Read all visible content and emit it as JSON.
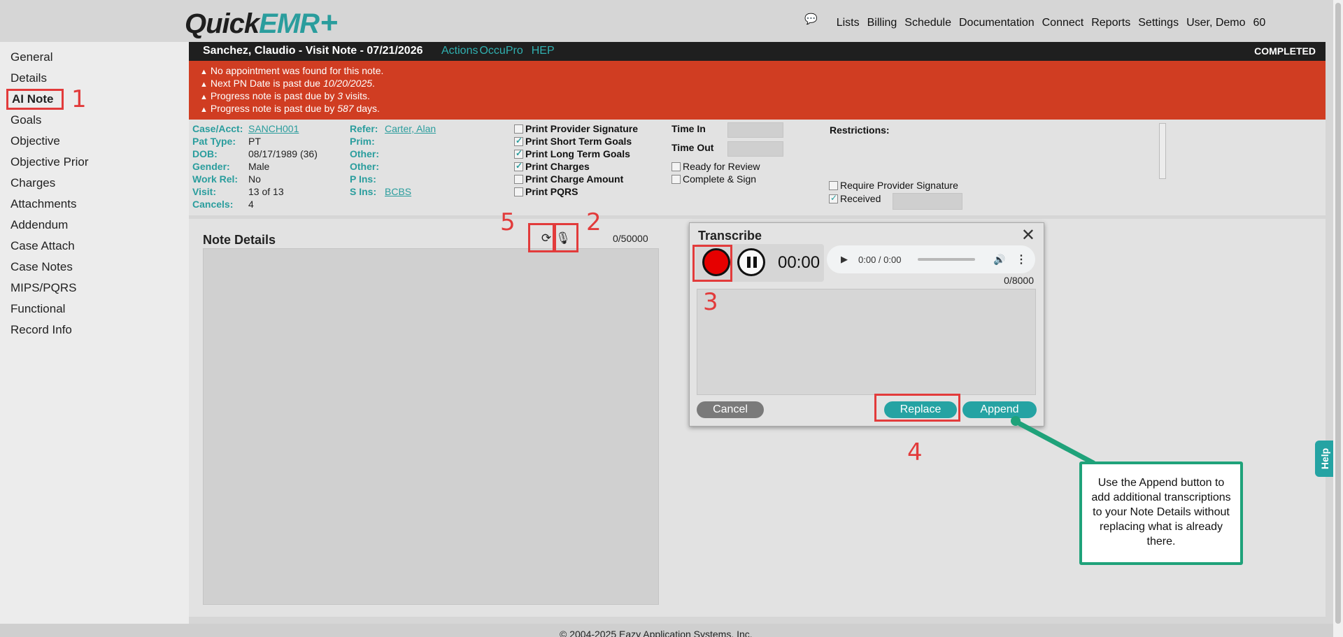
{
  "app": {
    "logo_quick": "Quick",
    "logo_emr": "EMR",
    "logo_plus": "+"
  },
  "topnav": {
    "chat_icon": "💬",
    "items": [
      "Lists",
      "Billing",
      "Schedule",
      "Documentation",
      "Connect",
      "Reports",
      "Settings",
      "User, Demo",
      "60"
    ]
  },
  "sidebar": {
    "items": [
      "General",
      "Details",
      "AI Note",
      "Goals",
      "Objective",
      "Objective Prior",
      "Charges",
      "Attachments",
      "Addendum",
      "Case Attach",
      "Case Notes",
      "MIPS/PQRS",
      "Functional",
      "Record Info"
    ],
    "active": "AI Note"
  },
  "header": {
    "title": "Sanchez, Claudio - Visit Note - 07/21/2026",
    "links": [
      "Actions",
      "OccuPro",
      "HEP"
    ],
    "status": "COMPLETED"
  },
  "alerts": [
    {
      "pre": "No appointment was found for this note.",
      "em": "",
      "post": ""
    },
    {
      "pre": "Next PN Date is past due ",
      "em": "10/20/2025",
      "post": "."
    },
    {
      "pre": "Progress note is past due by ",
      "em": "3",
      "post": " visits."
    },
    {
      "pre": "Progress note is past due by ",
      "em": "587",
      "post": " days."
    }
  ],
  "patient": {
    "case_label": "Case/Acct:",
    "case_value": "SANCH001",
    "pattype_label": "Pat Type:",
    "pattype_value": "PT",
    "dob_label": "DOB:",
    "dob_value": "08/17/1989 (36)",
    "gender_label": "Gender:",
    "gender_value": "Male",
    "workrel_label": "Work Rel:",
    "workrel_value": "No",
    "visit_label": "Visit:",
    "visit_value": "13 of 13",
    "cancels_label": "Cancels:",
    "cancels_value": "4",
    "refer_label": "Refer:",
    "refer_value": "Carter, Alan",
    "prim_label": "Prim:",
    "other1_label": "Other:",
    "other2_label": "Other:",
    "pins_label": "P Ins:",
    "sins_label": "S Ins:",
    "sins_value": "BCBS"
  },
  "print_options": [
    {
      "label": "Print Provider Signature",
      "checked": false
    },
    {
      "label": "Print Short Term Goals",
      "checked": true
    },
    {
      "label": "Print Long Term Goals",
      "checked": true
    },
    {
      "label": "Print Charges",
      "checked": true
    },
    {
      "label": "Print Charge Amount",
      "checked": false
    },
    {
      "label": "Print PQRS",
      "checked": false
    }
  ],
  "times": {
    "time_in_label": "Time In",
    "time_out_label": "Time Out",
    "ready_label": "Ready for Review",
    "complete_label": "Complete & Sign"
  },
  "restrictions": {
    "label": "Restrictions:",
    "require_sig_label": "Require Provider Signature",
    "received_label": "Received"
  },
  "note": {
    "title": "Note Details",
    "count": "0/50000",
    "refresh_icon": "⟳",
    "mic_icon": "🎙"
  },
  "transcribe": {
    "title": "Transcribe",
    "close": "✕",
    "timer": "00:00",
    "audio_time": "0:00 / 0:00",
    "count": "0/8000",
    "cancel": "Cancel",
    "replace": "Replace",
    "append": "Append"
  },
  "markers": [
    "1",
    "2",
    "3",
    "4",
    "5"
  ],
  "callout": "Use the Append button to add additional transcriptions to your Note Details without replacing what is already there.",
  "help": "Help",
  "footer": "© 2004-2025 Eazy Application Systems, Inc.",
  "colors": {
    "teal": "#2a9d9d",
    "alert_red": "#d03d22",
    "annotation_red": "#e23b3b",
    "callout_green": "#1fa27a"
  }
}
